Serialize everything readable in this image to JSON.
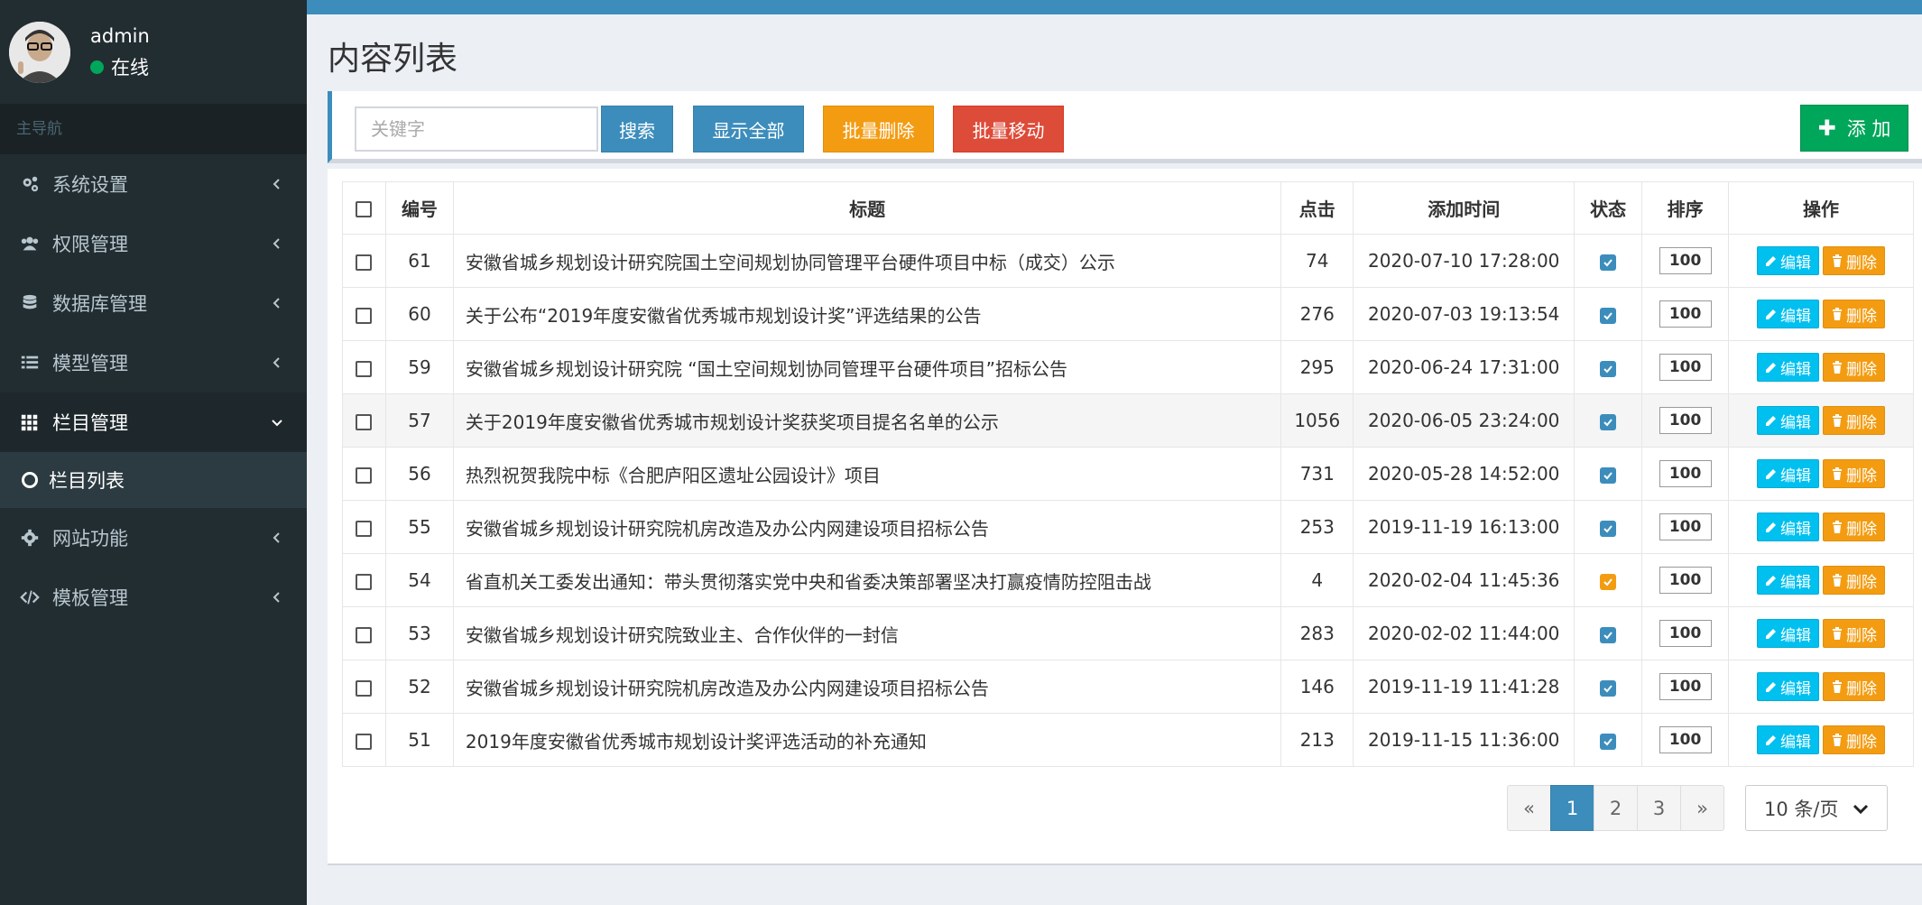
{
  "colors": {
    "sidebar_bg": "#222d32",
    "header_blue": "#3c8dbc",
    "success": "#00a65a",
    "warning": "#f39c12",
    "danger": "#dd4b39",
    "info": "#00c0ef"
  },
  "user": {
    "name": "admin",
    "status": "在线"
  },
  "sidebar": {
    "header": "主导航",
    "items": [
      {
        "label": "系统设置",
        "icon": "gears-icon"
      },
      {
        "label": "权限管理",
        "icon": "users-icon"
      },
      {
        "label": "数据库管理",
        "icon": "database-icon"
      },
      {
        "label": "模型管理",
        "icon": "list-icon"
      },
      {
        "label": "栏目管理",
        "icon": "grid-icon"
      },
      {
        "label": "网站功能",
        "icon": "gear-icon"
      },
      {
        "label": "模板管理",
        "icon": "code-icon"
      }
    ],
    "sub_item": "栏目列表"
  },
  "page": {
    "title": "内容列表"
  },
  "toolbar": {
    "search_placeholder": "关键字",
    "search": "搜索",
    "show_all": "显示全部",
    "batch_delete": "批量删除",
    "batch_move": "批量移动",
    "add": "添 加"
  },
  "table": {
    "headers": [
      "编号",
      "标题",
      "点击",
      "添加时间",
      "状态",
      "排序",
      "操作"
    ],
    "edit_label": "编辑",
    "delete_label": "删除",
    "rows": [
      {
        "id": "61",
        "title": "安徽省城乡规划设计研究院国土空间规划协同管理平台硬件项目中标（成交）公示",
        "clicks": "74",
        "time": "2020-07-10 17:28:00",
        "status_color": "#3c8dbc",
        "sort": "100"
      },
      {
        "id": "60",
        "title": "关于公布“2019年度安徽省优秀城市规划设计奖”评选结果的公告",
        "clicks": "276",
        "time": "2020-07-03 19:13:54",
        "status_color": "#3c8dbc",
        "sort": "100"
      },
      {
        "id": "59",
        "title": "安徽省城乡规划设计研究院 “国土空间规划协同管理平台硬件项目”招标公告",
        "clicks": "295",
        "time": "2020-06-24 17:31:00",
        "status_color": "#3c8dbc",
        "sort": "100"
      },
      {
        "id": "57",
        "title": "关于2019年度安徽省优秀城市规划设计奖获奖项目提名名单的公示",
        "clicks": "1056",
        "time": "2020-06-05 23:24:00",
        "status_color": "#3c8dbc",
        "sort": "100"
      },
      {
        "id": "56",
        "title": "热烈祝贺我院中标《合肥庐阳区遗址公园设计》项目",
        "clicks": "731",
        "time": "2020-05-28 14:52:00",
        "status_color": "#3c8dbc",
        "sort": "100"
      },
      {
        "id": "55",
        "title": "安徽省城乡规划设计研究院机房改造及办公内网建设项目招标公告",
        "clicks": "253",
        "time": "2019-11-19 16:13:00",
        "status_color": "#3c8dbc",
        "sort": "100"
      },
      {
        "id": "54",
        "title": "省直机关工委发出通知：带头贯彻落实党中央和省委决策部署坚决打赢疫情防控阻击战",
        "clicks": "4",
        "time": "2020-02-04 11:45:36",
        "status_color": "#f39c12",
        "sort": "100"
      },
      {
        "id": "53",
        "title": "安徽省城乡规划设计研究院致业主、合作伙伴的一封信",
        "clicks": "283",
        "time": "2020-02-02 11:44:00",
        "status_color": "#3c8dbc",
        "sort": "100"
      },
      {
        "id": "52",
        "title": "安徽省城乡规划设计研究院机房改造及办公内网建设项目招标公告",
        "clicks": "146",
        "time": "2019-11-19 11:41:28",
        "status_color": "#3c8dbc",
        "sort": "100"
      },
      {
        "id": "51",
        "title": "2019年度安徽省优秀城市规划设计奖评选活动的补充通知",
        "clicks": "213",
        "time": "2019-11-15 11:36:00",
        "status_color": "#3c8dbc",
        "sort": "100"
      }
    ]
  },
  "pagination": {
    "prev": "«",
    "pages": [
      "1",
      "2",
      "3"
    ],
    "next": "»",
    "page_size": "10 条/页"
  }
}
